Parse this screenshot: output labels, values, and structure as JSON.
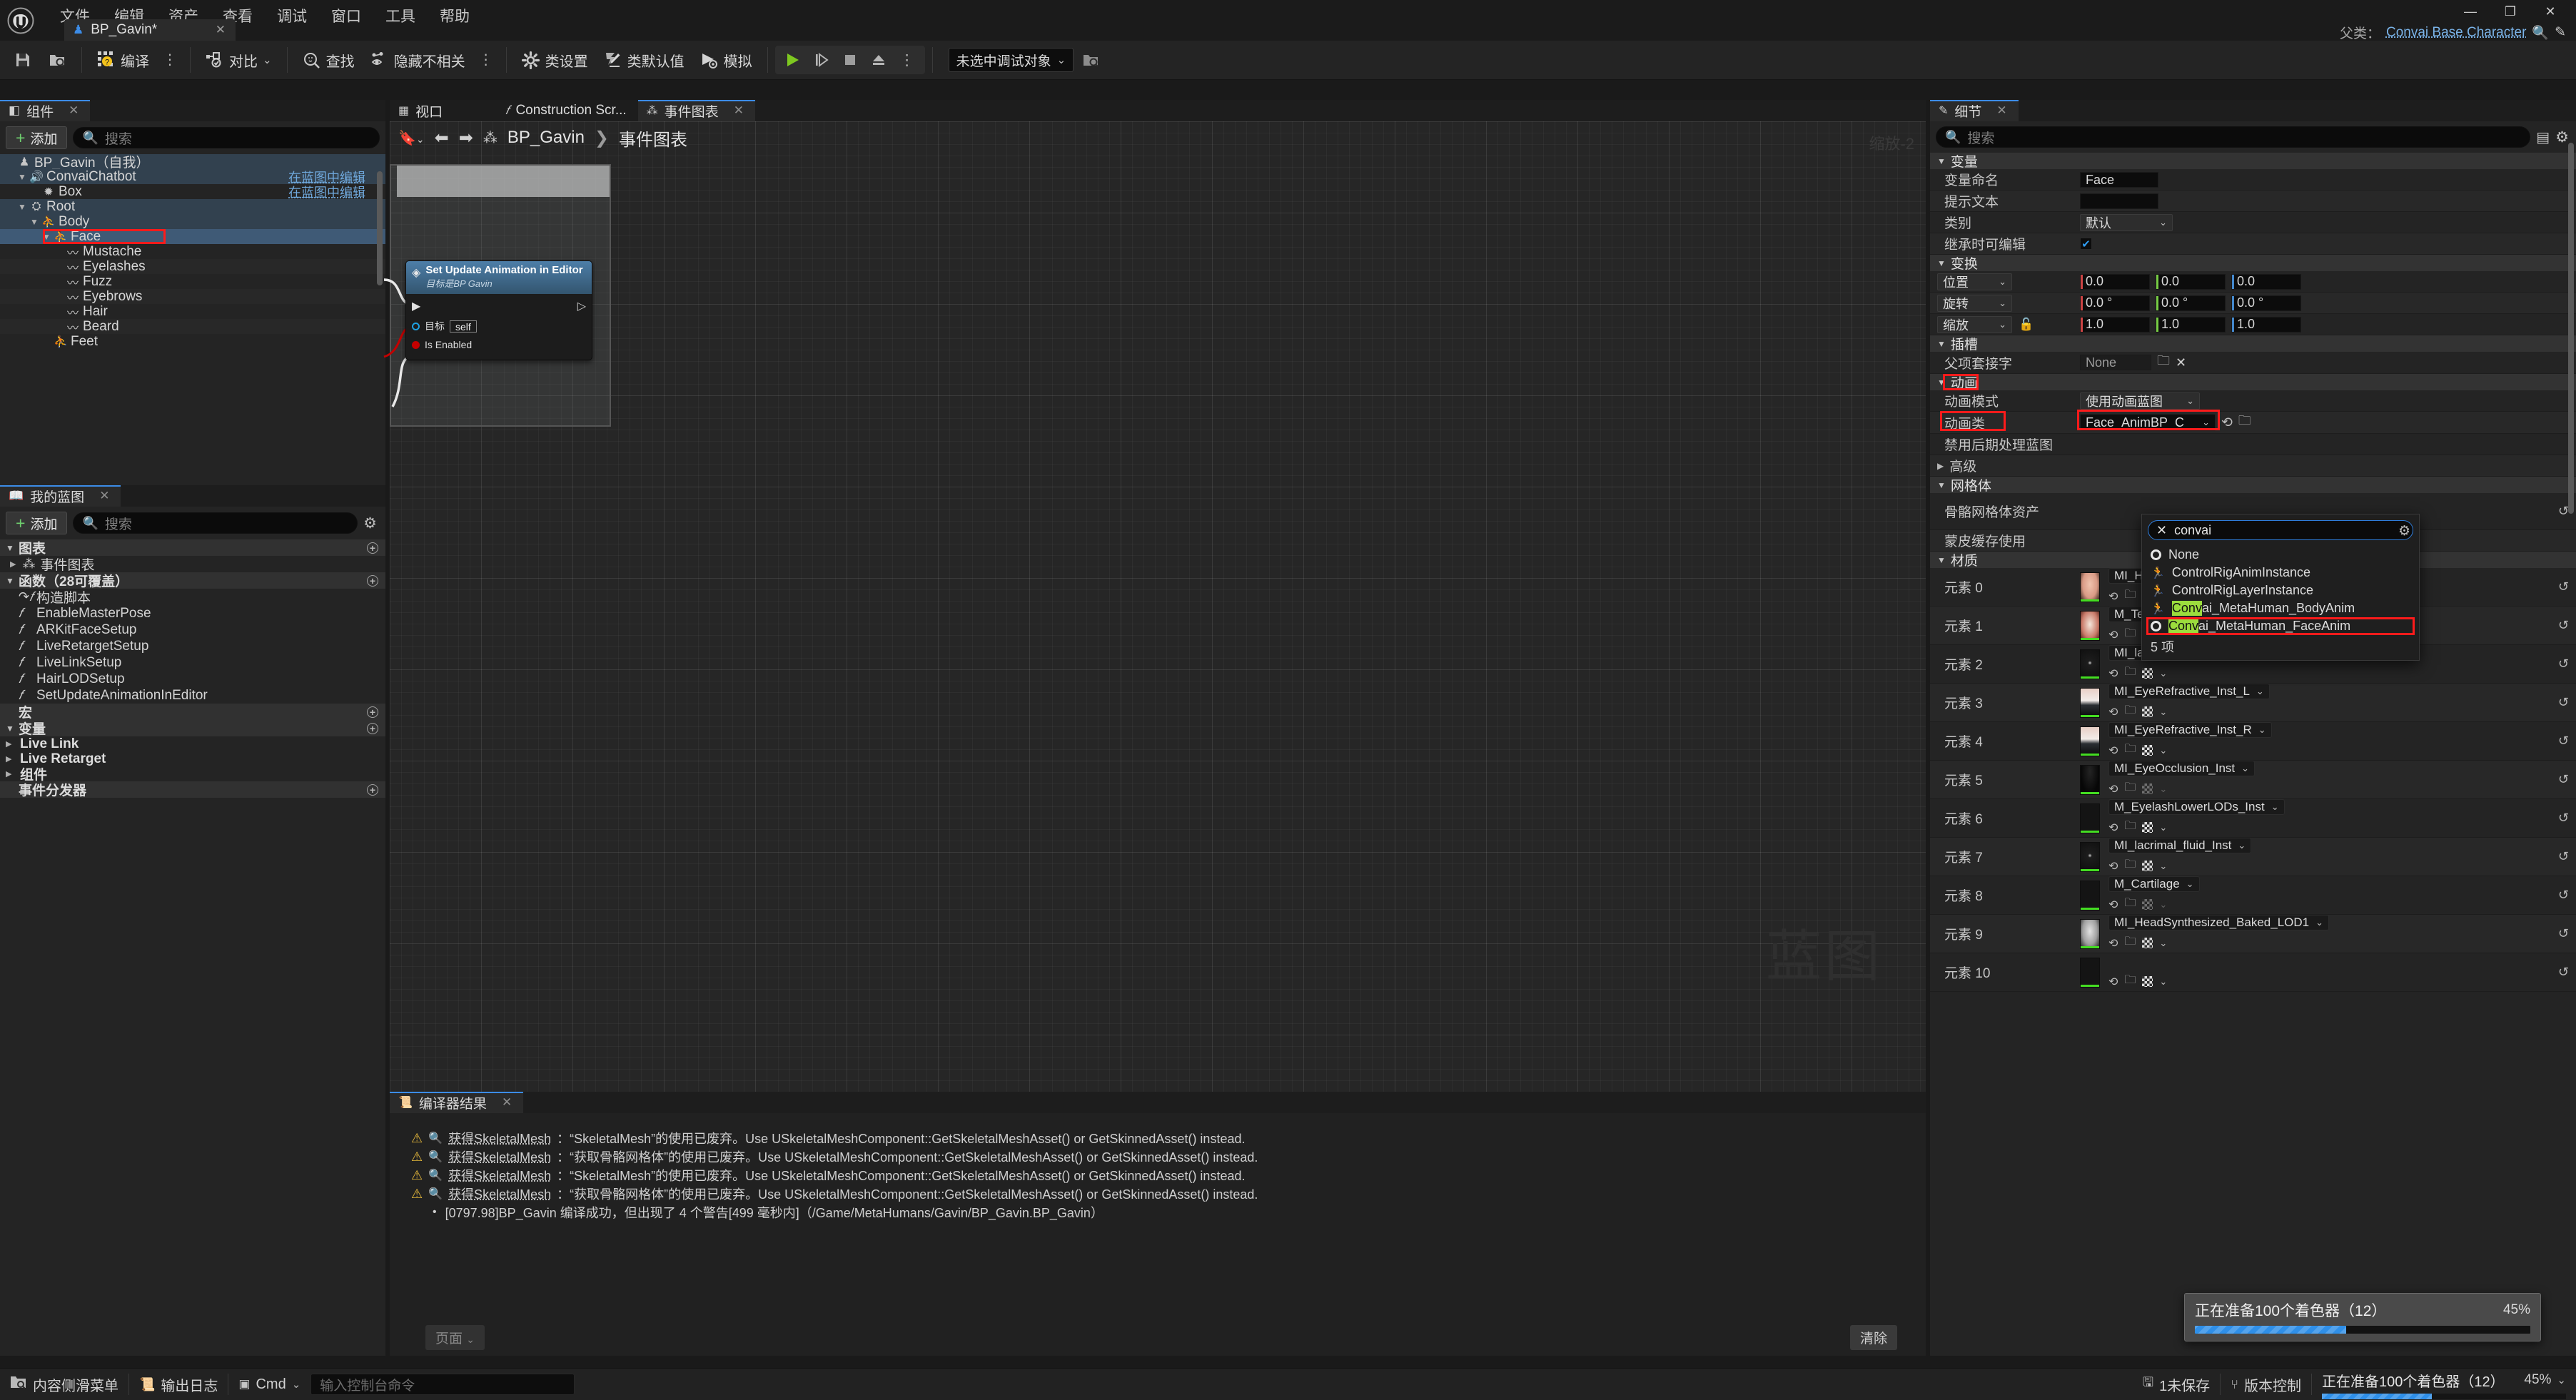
{
  "app": {
    "menus": [
      "文件",
      "编辑",
      "资产",
      "查看",
      "调试",
      "窗口",
      "工具",
      "帮助"
    ],
    "tab": {
      "label": "BP_Gavin*",
      "close": "✕",
      "icon": "pawn-icon"
    },
    "window_controls": {
      "minimize": "—",
      "maximize": "❐",
      "close": "✕"
    },
    "parent_class": {
      "label": "父类：",
      "value": "Convai Base Character"
    }
  },
  "toolbar": {
    "save": "保存",
    "browse": "浏览",
    "compile": "编译",
    "diff": "对比",
    "find": "查找",
    "hide_unrelated": "隐藏不相关",
    "class_settings": "类设置",
    "class_defaults": "类默认值",
    "simulate": "模拟",
    "debug_object": "未选中调试对象"
  },
  "components_panel": {
    "tab": "组件",
    "add": "添加",
    "search_placeholder": "搜索",
    "edit_in_bp": "在蓝图中编辑",
    "tree": [
      {
        "label": "BP_Gavin（自我）",
        "indent": 0,
        "icon": "pawn-icon",
        "tri": "",
        "state": "parentsel",
        "link": ""
      },
      {
        "label": "ConvaiChatbot",
        "indent": 1,
        "icon": "audio-icon",
        "tri": "▼",
        "state": "parentsel",
        "link": "在蓝图中编辑"
      },
      {
        "label": "Box",
        "indent": 2,
        "icon": "collision-icon",
        "tri": "",
        "state": "normal",
        "link": "在蓝图中编辑"
      },
      {
        "label": "Root",
        "indent": 1,
        "icon": "scene-icon",
        "tri": "▼",
        "state": "parentsel",
        "link": ""
      },
      {
        "label": "Body",
        "indent": 2,
        "icon": "skeletal-mesh-icon",
        "tri": "▼",
        "state": "parentsel",
        "link": ""
      },
      {
        "label": "Face",
        "indent": 3,
        "icon": "skeletal-mesh-icon",
        "tri": "▼",
        "state": "sel",
        "link": ""
      },
      {
        "label": "Mustache",
        "indent": 4,
        "icon": "groom-icon",
        "tri": "",
        "state": "normal",
        "link": ""
      },
      {
        "label": "Eyelashes",
        "indent": 4,
        "icon": "groom-icon",
        "tri": "",
        "state": "alt",
        "link": ""
      },
      {
        "label": "Fuzz",
        "indent": 4,
        "icon": "groom-icon",
        "tri": "",
        "state": "normal",
        "link": ""
      },
      {
        "label": "Eyebrows",
        "indent": 4,
        "icon": "groom-icon",
        "tri": "",
        "state": "alt",
        "link": ""
      },
      {
        "label": "Hair",
        "indent": 4,
        "icon": "groom-icon",
        "tri": "",
        "state": "normal",
        "link": ""
      },
      {
        "label": "Beard",
        "indent": 4,
        "icon": "groom-icon",
        "tri": "",
        "state": "alt",
        "link": ""
      },
      {
        "label": "Feet",
        "indent": 3,
        "icon": "skeletal-mesh-icon",
        "tri": "",
        "state": "normal",
        "link": ""
      }
    ]
  },
  "myblueprint_panel": {
    "tab": "我的蓝图",
    "add": "添加",
    "search_placeholder": "搜索",
    "sections": {
      "graphs": "图表",
      "functions": "函数（28可覆盖）",
      "macros": "宏",
      "variables": "变量",
      "event_dispatchers": "事件分发器"
    },
    "graphs": [
      "事件图表"
    ],
    "functions": [
      "构造脚本",
      "EnableMasterPose",
      "ARKitFaceSetup",
      "LiveRetargetSetup",
      "LiveLinkSetup",
      "HairLODSetup",
      "SetUpdateAnimationInEditor"
    ],
    "variables": [
      "Live Link",
      "Live Retarget",
      "组件"
    ]
  },
  "graph": {
    "tabs": [
      {
        "label": "视口",
        "icon": "viewport-icon",
        "active": false,
        "closable": false
      },
      {
        "label": "Construction Scr...",
        "icon": "function-icon",
        "active": false,
        "closable": false
      },
      {
        "label": "事件图表",
        "icon": "graph-icon",
        "active": true,
        "closable": true
      }
    ],
    "breadcrumb": {
      "root": "BP_Gavin",
      "sep": "❯",
      "leaf": "事件图表"
    },
    "zoom_label": "缩放-2",
    "watermark": "蓝图",
    "node": {
      "title": "Set Update Animation in Editor",
      "subtitle": "目标是BP Gavin",
      "target_label": "目标",
      "target_value": "self",
      "bool_label": "Is Enabled"
    }
  },
  "compiler_panel": {
    "tab": "编译器结果",
    "page_button": "页面",
    "clear_button": "清除",
    "rows": [
      {
        "type": "warning",
        "link": "获得SkeletalMesh",
        "text": "：“SkeletalMesh”的使用已废弃。Use USkeletalMeshComponent::GetSkeletalMeshAsset() or GetSkinnedAsset() instead."
      },
      {
        "type": "warning",
        "link": "获得SkeletalMesh",
        "text": "：“获取骨骼网格体”的使用已废弃。Use USkeletalMeshComponent::GetSkeletalMeshAsset() or GetSkinnedAsset() instead."
      },
      {
        "type": "warning",
        "link": "获得SkeletalMesh",
        "text": "：“SkeletalMesh”的使用已废弃。Use USkeletalMeshComponent::GetSkeletalMeshAsset() or GetSkinnedAsset() instead."
      },
      {
        "type": "warning",
        "link": "获得SkeletalMesh",
        "text": "：“获取骨骼网格体”的使用已废弃。Use USkeletalMeshComponent::GetSkeletalMeshAsset() or GetSkinnedAsset() instead."
      },
      {
        "type": "info",
        "link": "",
        "text": "[0797.98]BP_Gavin 编译成功，但出现了 4 个警告[499 毫秒内]（/Game/MetaHumans/Gavin/BP_Gavin.BP_Gavin）"
      }
    ]
  },
  "details_panel": {
    "tab": "细节",
    "search_placeholder": "搜索",
    "sections": {
      "variable": "变量",
      "transform": "变换",
      "socket": "插槽",
      "animation": "动画",
      "mesh": "网格体",
      "materials": "材质"
    },
    "variable": {
      "name_label": "变量命名",
      "name_value": "Face",
      "tooltip_label": "提示文本",
      "tooltip_value": "",
      "category_label": "类别",
      "category_value": "默认",
      "editable_label": "继承时可编辑",
      "editable_checked": true
    },
    "transform": {
      "location_label": "位置",
      "location": [
        "0.0",
        "0.0",
        "0.0"
      ],
      "rotation_label": "旋转",
      "rotation": [
        "0.0 °",
        "0.0 °",
        "0.0 °"
      ],
      "scale_label": "缩放",
      "scale": [
        "1.0",
        "1.0",
        "1.0"
      ]
    },
    "socket": {
      "parent_socket_label": "父项套接字",
      "parent_socket_value": "None"
    },
    "animation": {
      "mode_label": "动画模式",
      "mode_value": "使用动画蓝图",
      "class_label": "动画类",
      "class_value": "Face_AnimBP_C",
      "disable_postprocess_label": "禁用后期处理蓝图",
      "advanced_label": "高级"
    },
    "mesh": {
      "skeletal_mesh_label": "骨骼网格体资产",
      "skin_cache_label": "蒙皮缓存使用"
    },
    "anim_dropdown": {
      "search_value": "convai",
      "count_label": "5 项",
      "items": [
        {
          "icon": "blueprint-circle-icon",
          "pre": "",
          "hl": "",
          "post": "None"
        },
        {
          "icon": "anim-run-icon",
          "pre": "",
          "hl": "",
          "post": "ControlRigAnimInstance"
        },
        {
          "icon": "anim-run-icon",
          "pre": "",
          "hl": "",
          "post": "ControlRigLayerInstance"
        },
        {
          "icon": "anim-run-icon",
          "pre": "",
          "hl": "Conv",
          "post": "ai_MetaHuman_BodyAnim"
        },
        {
          "icon": "blueprint-circle-icon",
          "pre": "",
          "hl": "Conv",
          "post": "ai_MetaHuman_FaceAnim",
          "highlighted_box": true
        }
      ]
    },
    "materials": [
      {
        "element": "元素 0",
        "value": "MI_HeadSynthesized_Baked",
        "thumb": "head",
        "disabled_checker": false
      },
      {
        "element": "元素 1",
        "value": "M_TeethCharacterCreator_Inst",
        "thumb": "teeth",
        "disabled_checker": false
      },
      {
        "element": "元素 2",
        "value": "MI_lacrimal_fluid_Inst",
        "thumb": "dark-dot",
        "disabled_checker": false
      },
      {
        "element": "元素 3",
        "value": "MI_EyeRefractive_Inst_L",
        "thumb": "eye",
        "disabled_checker": false
      },
      {
        "element": "元素 4",
        "value": "MI_EyeRefractive_Inst_R",
        "thumb": "eye",
        "disabled_checker": false
      },
      {
        "element": "元素 5",
        "value": "MI_EyeOcclusion_Inst",
        "thumb": "black",
        "disabled_checker": true
      },
      {
        "element": "元素 6",
        "value": "M_EyelashLowerLODs_Inst",
        "thumb": "checker",
        "disabled_checker": false
      },
      {
        "element": "元素 7",
        "value": "MI_lacrimal_fluid_Inst",
        "thumb": "dark-dot",
        "disabled_checker": false
      },
      {
        "element": "元素 8",
        "value": "M_Cartilage",
        "thumb": "checker",
        "disabled_checker": true
      },
      {
        "element": "元素 9",
        "value": "MI_HeadSynthesized_Baked_LOD1",
        "thumb": "head-grey",
        "disabled_checker": false
      },
      {
        "element": "元素 10",
        "value": "",
        "thumb": "checker",
        "disabled_checker": false
      }
    ]
  },
  "toast": {
    "text": "正在准备100个着色器（12）",
    "percent": "45%",
    "progress": 45
  },
  "statusbar": {
    "content_drawer": "内容侧滑菜单",
    "output_log": "输出日志",
    "cmd": "Cmd",
    "cmd_placeholder": "输入控制台命令",
    "unsaved": "1未保存",
    "source_control": "版本控制",
    "progress_text": "正在准备100个着色器（12）",
    "progress_percent": "45%"
  },
  "colors": {
    "accent": "#3c8ce7",
    "selection": "#3f5a76",
    "highlight": "#9bdd3d",
    "warning": "#e7b93b",
    "red_box": "#ff1b1b",
    "green": "#6fd06f"
  }
}
